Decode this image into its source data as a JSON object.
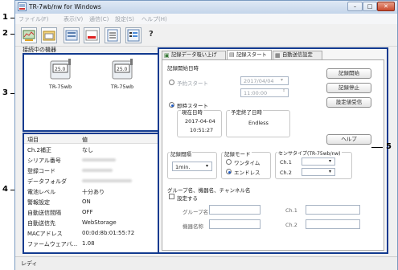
{
  "window": {
    "title": "TR-7wb/nw for Windows"
  },
  "menu": [
    "ファイル(F)",
    "表示(V)",
    "通信(C)",
    "設定(S)",
    "ヘルプ(H)"
  ],
  "toolbar": {
    "help_label": "?"
  },
  "callouts": [
    "1",
    "2",
    "3",
    "4",
    "5"
  ],
  "devices": {
    "header": "接続中の機器",
    "items": [
      {
        "label": "TR-75wb"
      },
      {
        "label": "TR-75wb"
      }
    ]
  },
  "props": {
    "col_item": "項目",
    "col_value": "値",
    "rows": [
      {
        "item": "Ch.2補正",
        "value": "なし"
      },
      {
        "item": "シリアル番号",
        "value": ""
      },
      {
        "item": "登録コード",
        "value": ""
      },
      {
        "item": "データフォルダ",
        "value": ""
      },
      {
        "item": "電池レベル",
        "value": "十分あり"
      },
      {
        "item": "警報設定",
        "value": "ON"
      },
      {
        "item": "自動送信間隔",
        "value": "OFF"
      },
      {
        "item": "自動送信先",
        "value": "WebStorage"
      },
      {
        "item": "MACアドレス",
        "value": "00:0d:8b:01:55:72"
      },
      {
        "item": "ファームウェアバ...",
        "value": "1.08"
      }
    ]
  },
  "tabs": [
    {
      "label": "記録データ吸い上げ"
    },
    {
      "label": "記録スタート"
    },
    {
      "label": "自動送信設定"
    }
  ],
  "rec": {
    "start_datetime_label": "記録開始日時",
    "reserve_label": "予約スタート",
    "date_value": "2017/04/04",
    "time_value": "11:00:00",
    "instant_label": "即時スタート",
    "now_label": "現在日時",
    "now_date": "2017-04-04",
    "now_time": "10:51:27",
    "end_label": "予定終了日時",
    "end_value": "Endless",
    "btn_start": "記録開始",
    "btn_stop": "記録停止",
    "btn_recv": "設定値受信",
    "btn_help": "ヘルプ",
    "interval_label": "記録間隔",
    "interval_value": "1min.",
    "mode_label": "記録モード",
    "mode_oneshot": "ワンタイム",
    "mode_endless": "エンドレス",
    "sensor_label": "センサタイプ(TR-75wb/nw)",
    "ch1_label": "Ch.1",
    "ch2_label": "Ch.2",
    "group_label": "グループ名、機器名、チャンネル名",
    "set_label": "設定する",
    "group_name_label": "グループ名",
    "device_name_label": "機器名称",
    "gch1_label": "Ch.1",
    "gch2_label": "Ch.2"
  },
  "status": {
    "text": "レディ"
  }
}
